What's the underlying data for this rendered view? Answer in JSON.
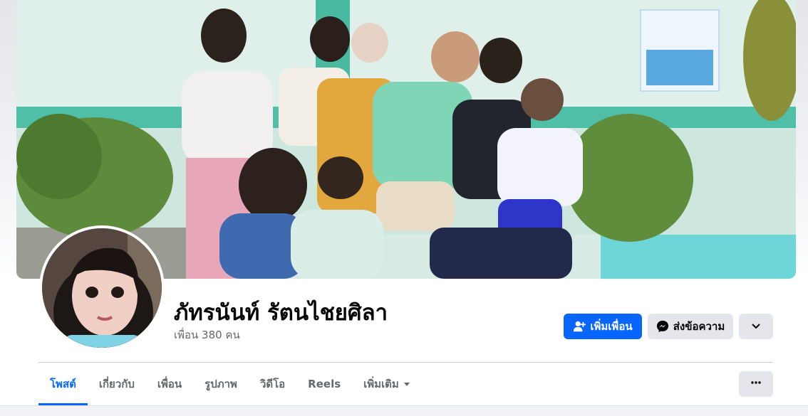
{
  "profile": {
    "name": "ภัทรนันท์ รัตนไชยศิลา",
    "friends_count": "เพื่อน 380 คน"
  },
  "actions": {
    "add_friend_label": "เพิ่มเพื่อน",
    "message_label": "ส่งข้อความ",
    "more_icon": "chevron-down-icon"
  },
  "tabs": [
    {
      "label": "โพสต์",
      "active": true
    },
    {
      "label": "เกี่ยวกับ",
      "active": false
    },
    {
      "label": "เพื่อน",
      "active": false
    },
    {
      "label": "รูปภาพ",
      "active": false
    },
    {
      "label": "วิดีโอ",
      "active": false
    },
    {
      "label": "Reels",
      "active": false
    },
    {
      "label": "เพิ่มเติม",
      "active": false,
      "icon": "caret-down-icon"
    }
  ],
  "tab_actions": {
    "icon": "ellipsis-icon"
  },
  "colors": {
    "accent": "#0866ff",
    "secondary_button": "#e4e6eb",
    "muted_text": "#65676b",
    "page_background": "#f0f2f5"
  }
}
